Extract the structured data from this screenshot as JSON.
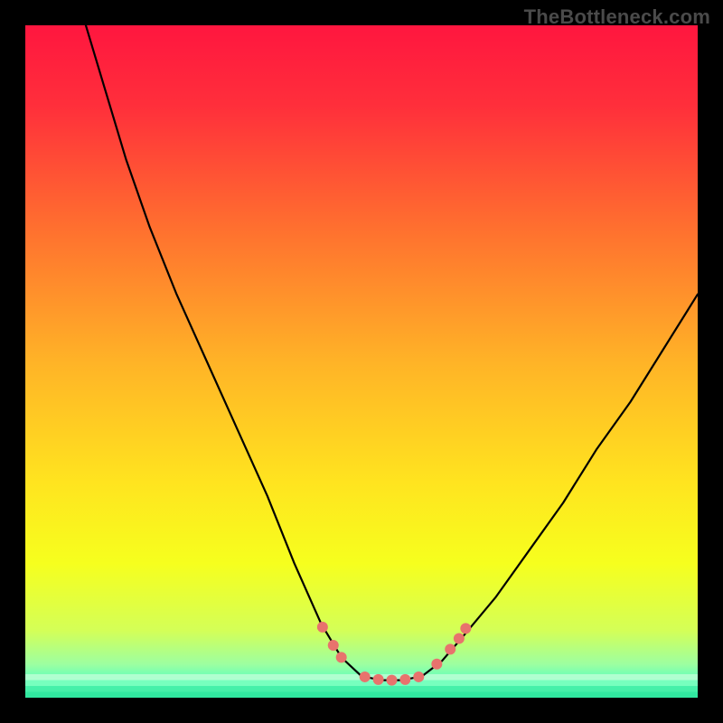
{
  "watermark": "TheBottleneck.com",
  "chart_data": {
    "type": "line",
    "title": "",
    "xlabel": "",
    "ylabel": "",
    "xlim": [
      0,
      100
    ],
    "ylim": [
      0,
      100
    ],
    "grid": false,
    "legend": false,
    "background": {
      "style": "vertical-gradient",
      "stops": [
        {
          "offset": 0.0,
          "color": "#ff163f"
        },
        {
          "offset": 0.12,
          "color": "#ff2f3b"
        },
        {
          "offset": 0.3,
          "color": "#ff6f2f"
        },
        {
          "offset": 0.5,
          "color": "#ffb327"
        },
        {
          "offset": 0.68,
          "color": "#ffe41f"
        },
        {
          "offset": 0.8,
          "color": "#f6ff1e"
        },
        {
          "offset": 0.9,
          "color": "#d4ff57"
        },
        {
          "offset": 0.95,
          "color": "#9dffa0"
        },
        {
          "offset": 0.975,
          "color": "#5cffbf"
        },
        {
          "offset": 1.0,
          "color": "#31e8a0"
        }
      ]
    },
    "curve": {
      "color": "#000000",
      "points": [
        {
          "x": 9.0,
          "y": 100.0
        },
        {
          "x": 12.0,
          "y": 90.0
        },
        {
          "x": 15.0,
          "y": 80.0
        },
        {
          "x": 18.5,
          "y": 70.0
        },
        {
          "x": 22.5,
          "y": 60.0
        },
        {
          "x": 27.0,
          "y": 50.0
        },
        {
          "x": 31.5,
          "y": 40.0
        },
        {
          "x": 36.0,
          "y": 30.0
        },
        {
          "x": 40.0,
          "y": 20.0
        },
        {
          "x": 44.0,
          "y": 11.0
        },
        {
          "x": 47.0,
          "y": 6.0
        },
        {
          "x": 50.0,
          "y": 3.2
        },
        {
          "x": 53.0,
          "y": 2.6
        },
        {
          "x": 56.0,
          "y": 2.6
        },
        {
          "x": 59.0,
          "y": 3.2
        },
        {
          "x": 62.0,
          "y": 5.5
        },
        {
          "x": 65.0,
          "y": 9.0
        },
        {
          "x": 70.0,
          "y": 15.0
        },
        {
          "x": 75.0,
          "y": 22.0
        },
        {
          "x": 80.0,
          "y": 29.0
        },
        {
          "x": 85.0,
          "y": 37.0
        },
        {
          "x": 90.0,
          "y": 44.0
        },
        {
          "x": 95.0,
          "y": 52.0
        },
        {
          "x": 100.0,
          "y": 60.0
        }
      ]
    },
    "markers": {
      "color": "#e8736d",
      "radius_px": 6,
      "points": [
        {
          "x": 44.2,
          "y": 10.5
        },
        {
          "x": 45.8,
          "y": 7.8
        },
        {
          "x": 47.0,
          "y": 6.0
        },
        {
          "x": 50.5,
          "y": 3.1
        },
        {
          "x": 52.5,
          "y": 2.7
        },
        {
          "x": 54.5,
          "y": 2.6
        },
        {
          "x": 56.5,
          "y": 2.7
        },
        {
          "x": 58.5,
          "y": 3.1
        },
        {
          "x": 61.2,
          "y": 5.0
        },
        {
          "x": 63.2,
          "y": 7.2
        },
        {
          "x": 64.5,
          "y": 8.8
        },
        {
          "x": 65.5,
          "y": 10.3
        }
      ]
    },
    "bottom_band": {
      "y_from": 0.0,
      "y_to": 3.5,
      "overlay_colors": [
        "#b8ffd3",
        "#7bffbf",
        "#46f0a8",
        "#31e8a0"
      ]
    }
  }
}
